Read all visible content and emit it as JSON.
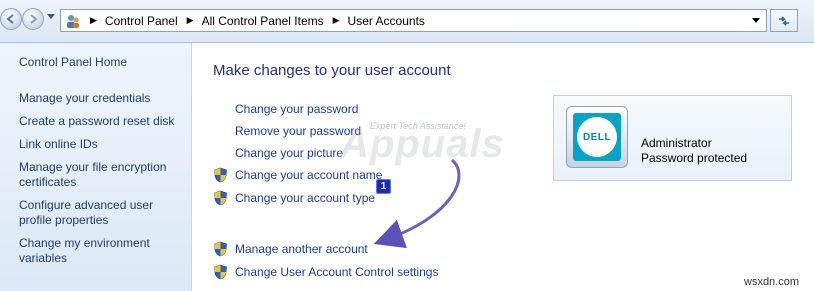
{
  "breadcrumb": [
    "Control Panel",
    "All Control Panel Items",
    "User Accounts"
  ],
  "sidebar": {
    "home": "Control Panel Home",
    "items": [
      "Manage your credentials",
      "Create a password reset disk",
      "Link online IDs",
      "Manage your file encryption certificates",
      "Configure advanced user profile properties",
      "Change my environment variables"
    ]
  },
  "main": {
    "title": "Make changes to your user account",
    "tasks": [
      {
        "label": "Change your password",
        "shield": false
      },
      {
        "label": "Remove your password",
        "shield": false
      },
      {
        "label": "Change your picture",
        "shield": false
      },
      {
        "label": "Change your account name",
        "shield": true
      },
      {
        "label": "Change your account type",
        "shield": true
      },
      {
        "label": "Manage another account",
        "shield": true
      },
      {
        "label": "Change User Account Control settings",
        "shield": true
      }
    ]
  },
  "account": {
    "name": "Administrator",
    "status": "Password protected",
    "avatar_logo": "DELL"
  },
  "overlay": {
    "badge_number": "1",
    "watermark_tagline": "Expert Tech Assistance!",
    "watermark_brand": "Appuals",
    "site_mark": "wsxdn.com"
  },
  "colors": {
    "link": "#1b3c9c",
    "title": "#1e3287",
    "annotation": "#1c2db5",
    "arrow": "#4a3fb0"
  },
  "icons": [
    "back-arrow-icon",
    "forward-arrow-icon",
    "user-accounts-icon",
    "refresh-icon",
    "uac-shield-icon",
    "dell-logo"
  ]
}
